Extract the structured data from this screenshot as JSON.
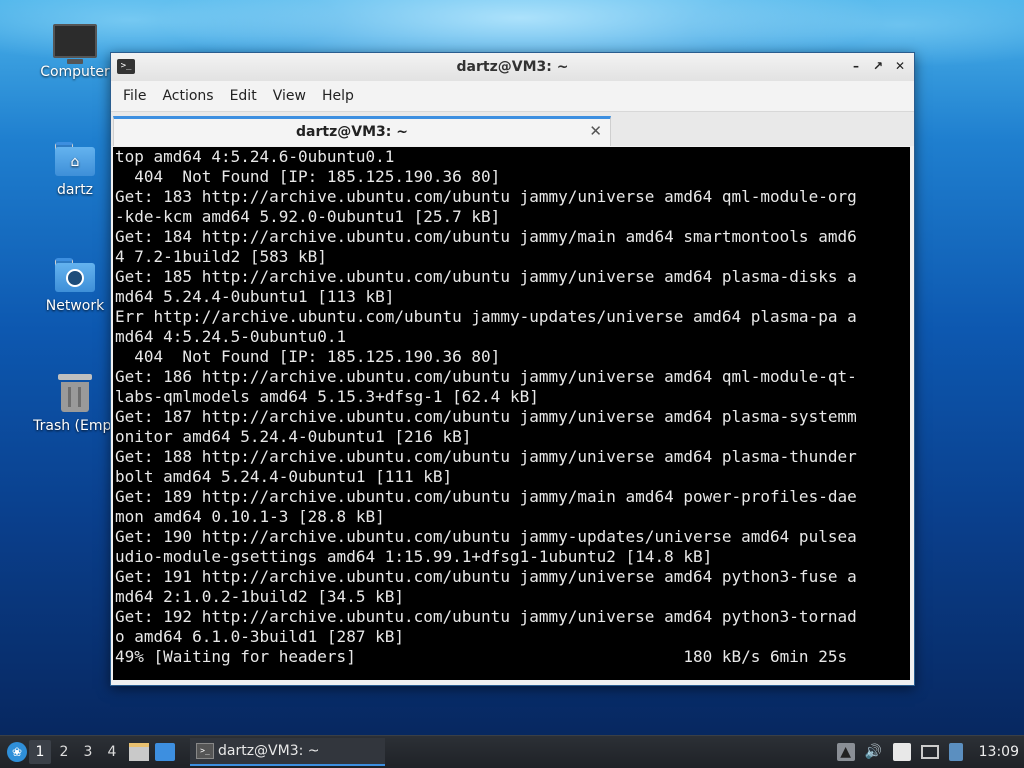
{
  "desktop": {
    "icons": [
      {
        "label": "Computer"
      },
      {
        "label": "dartz"
      },
      {
        "label": "Network"
      },
      {
        "label": "Trash (Empt"
      }
    ]
  },
  "window": {
    "title": "dartz@VM3: ~",
    "menu": [
      "File",
      "Actions",
      "Edit",
      "View",
      "Help"
    ],
    "tab_label": "dartz@VM3: ~",
    "terminal_lines": [
      "top amd64 4:5.24.6-0ubuntu0.1",
      "  404  Not Found [IP: 185.125.190.36 80]",
      "Get: 183 http://archive.ubuntu.com/ubuntu jammy/universe amd64 qml-module-org",
      "-kde-kcm amd64 5.92.0-0ubuntu1 [25.7 kB]",
      "Get: 184 http://archive.ubuntu.com/ubuntu jammy/main amd64 smartmontools amd6",
      "4 7.2-1build2 [583 kB]",
      "Get: 185 http://archive.ubuntu.com/ubuntu jammy/universe amd64 plasma-disks a",
      "md64 5.24.4-0ubuntu1 [113 kB]",
      "Err http://archive.ubuntu.com/ubuntu jammy-updates/universe amd64 plasma-pa a",
      "md64 4:5.24.5-0ubuntu0.1",
      "  404  Not Found [IP: 185.125.190.36 80]",
      "Get: 186 http://archive.ubuntu.com/ubuntu jammy/universe amd64 qml-module-qt-",
      "labs-qmlmodels amd64 5.15.3+dfsg-1 [62.4 kB]",
      "Get: 187 http://archive.ubuntu.com/ubuntu jammy/universe amd64 plasma-systemm",
      "onitor amd64 5.24.4-0ubuntu1 [216 kB]",
      "Get: 188 http://archive.ubuntu.com/ubuntu jammy/universe amd64 plasma-thunder",
      "bolt amd64 5.24.4-0ubuntu1 [111 kB]",
      "Get: 189 http://archive.ubuntu.com/ubuntu jammy/main amd64 power-profiles-dae",
      "mon amd64 0.10.1-3 [28.8 kB]",
      "Get: 190 http://archive.ubuntu.com/ubuntu jammy-updates/universe amd64 pulsea",
      "udio-module-gsettings amd64 1:15.99.1+dfsg1-1ubuntu2 [14.8 kB]",
      "Get: 191 http://archive.ubuntu.com/ubuntu jammy/universe amd64 python3-fuse a",
      "md64 2:1.0.2-1build2 [34.5 kB]",
      "Get: 192 http://archive.ubuntu.com/ubuntu jammy/universe amd64 python3-tornad",
      "o amd64 6.1.0-3build1 [287 kB]",
      "49% [Waiting for headers]                                  180 kB/s 6min 25s"
    ]
  },
  "taskbar": {
    "workspaces": [
      "1",
      "2",
      "3",
      "4"
    ],
    "active_workspace": "1",
    "task_title": "dartz@VM3: ~",
    "clock": "13:09",
    "tray_icons": [
      "updates-icon",
      "volume-icon",
      "clipboard-icon",
      "network-icon",
      "notification-icon"
    ]
  },
  "colors": {
    "terminal_bg": "#000000",
    "terminal_fg": "#e8e8e8",
    "accent": "#3d8fe0"
  }
}
